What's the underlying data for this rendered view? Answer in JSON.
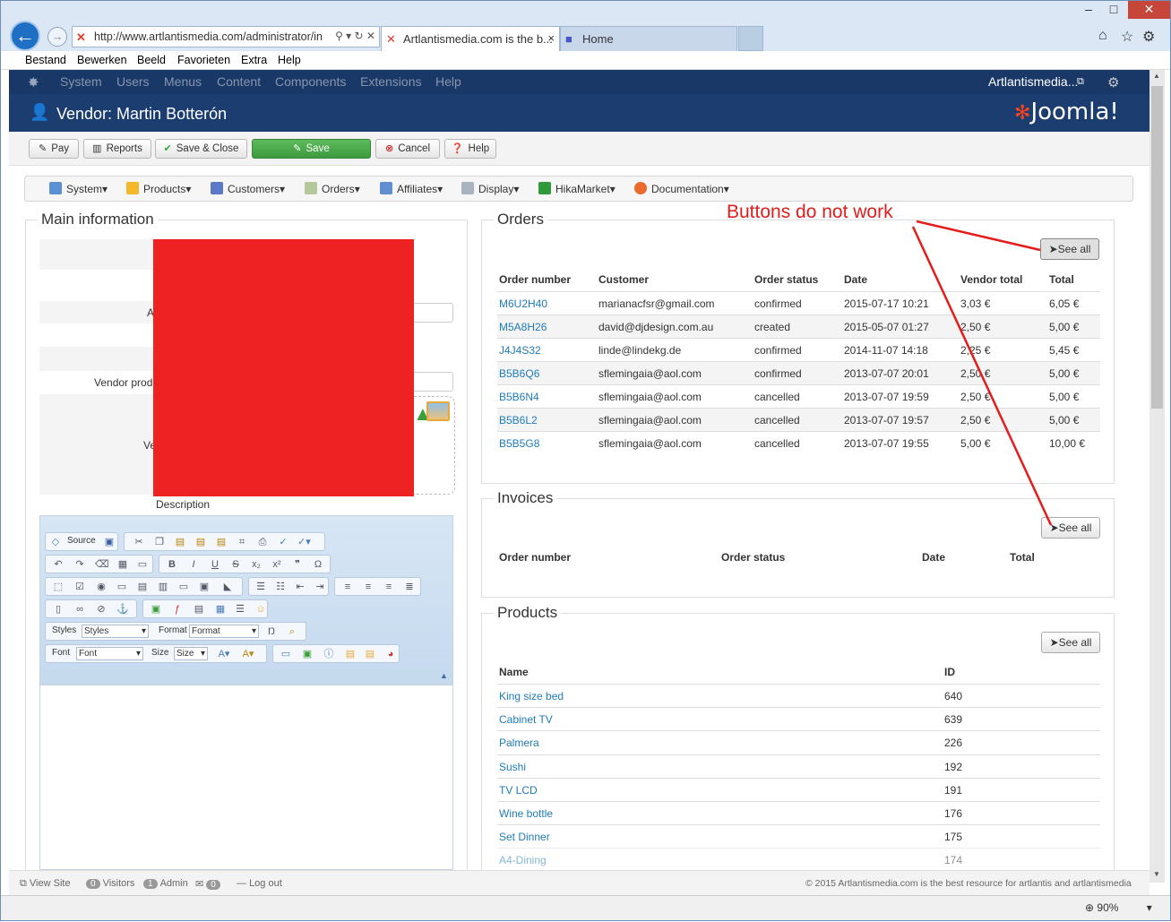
{
  "browser": {
    "address": "http://www.artlantismedia.com/administrator/in",
    "tabs": [
      {
        "label": "Artlantismedia.com is the b...",
        "active": true
      },
      {
        "label": "Home",
        "active": false
      }
    ],
    "menu": [
      "Bestand",
      "Bewerken",
      "Beeld",
      "Favorieten",
      "Extra",
      "Help"
    ],
    "zoom": "90%"
  },
  "joomla": {
    "nav": [
      "System",
      "Users",
      "Menus",
      "Content",
      "Components",
      "Extensions",
      "Help"
    ],
    "site_link": "Artlantismedia...",
    "page_title": "Vendor: Martin Botterón",
    "logo": "Joomla!",
    "toolbar": {
      "pay": "Pay",
      "reports": "Reports",
      "save_close": "Save & Close",
      "save": "Save",
      "cancel": "Cancel",
      "help": "Help"
    },
    "footer": {
      "view_site": "View Site",
      "visitors_count": "0",
      "visitors": "Visitors",
      "admin_count": "1",
      "admin": "Admin",
      "messages_count": "0",
      "logout": "Log out",
      "copyright": "© 2015 Artlantismedia.com is the best resource for artlantis and artlantismedia"
    }
  },
  "hikamenu": [
    "System",
    "Products",
    "Customers",
    "Orders",
    "Affiliates",
    "Display",
    "HikaMarket",
    "Documentation"
  ],
  "main_info": {
    "legend": "Main information",
    "label_a": "A",
    "label_vendor_prod": "Vendor produ",
    "label_ve": "Ve",
    "description_label": "Description"
  },
  "editor": {
    "source": "Source",
    "styles_label": "Styles",
    "styles_value": "Styles",
    "format_label": "Format",
    "format_value": "Format",
    "font_label": "Font",
    "font_value": "Font",
    "size_label": "Size",
    "size_value": "Size"
  },
  "orders": {
    "legend": "Orders",
    "see_all": "See all",
    "headers": [
      "Order number",
      "Customer",
      "Order status",
      "Date",
      "Vendor total",
      "Total"
    ],
    "rows": [
      [
        "M6U2H40",
        "marianacfsr@gmail.com",
        "confirmed",
        "2015-07-17 10:21",
        "3,03 €",
        "6,05 €"
      ],
      [
        "M5A8H26",
        "david@djdesign.com.au",
        "created",
        "2015-05-07 01:27",
        "2,50 €",
        "5,00 €"
      ],
      [
        "J4J4S32",
        "linde@lindekg.de",
        "confirmed",
        "2014-11-07 14:18",
        "2,25 €",
        "5,45 €"
      ],
      [
        "B5B6Q6",
        "sflemingaia@aol.com",
        "confirmed",
        "2013-07-07 20:01",
        "2,50 €",
        "5,00 €"
      ],
      [
        "B5B6N4",
        "sflemingaia@aol.com",
        "cancelled",
        "2013-07-07 19:59",
        "2,50 €",
        "5,00 €"
      ],
      [
        "B5B6L2",
        "sflemingaia@aol.com",
        "cancelled",
        "2013-07-07 19:57",
        "2,50 €",
        "5,00 €"
      ],
      [
        "B5B5G8",
        "sflemingaia@aol.com",
        "cancelled",
        "2013-07-07 19:55",
        "5,00 €",
        "10,00 €"
      ]
    ]
  },
  "invoices": {
    "legend": "Invoices",
    "see_all": "See all",
    "headers": [
      "Order number",
      "Order status",
      "Date",
      "Total"
    ]
  },
  "products": {
    "legend": "Products",
    "see_all": "See all",
    "headers": [
      "Name",
      "ID"
    ],
    "rows": [
      [
        "King size bed",
        "640"
      ],
      [
        "Cabinet TV",
        "639"
      ],
      [
        "Palmera",
        "226"
      ],
      [
        "Sushi",
        "192"
      ],
      [
        "TV LCD",
        "191"
      ],
      [
        "Wine bottle",
        "176"
      ],
      [
        "Set Dinner",
        "175"
      ],
      [
        "A4-Dining",
        "174"
      ]
    ]
  },
  "annotation": "Buttons do not work"
}
